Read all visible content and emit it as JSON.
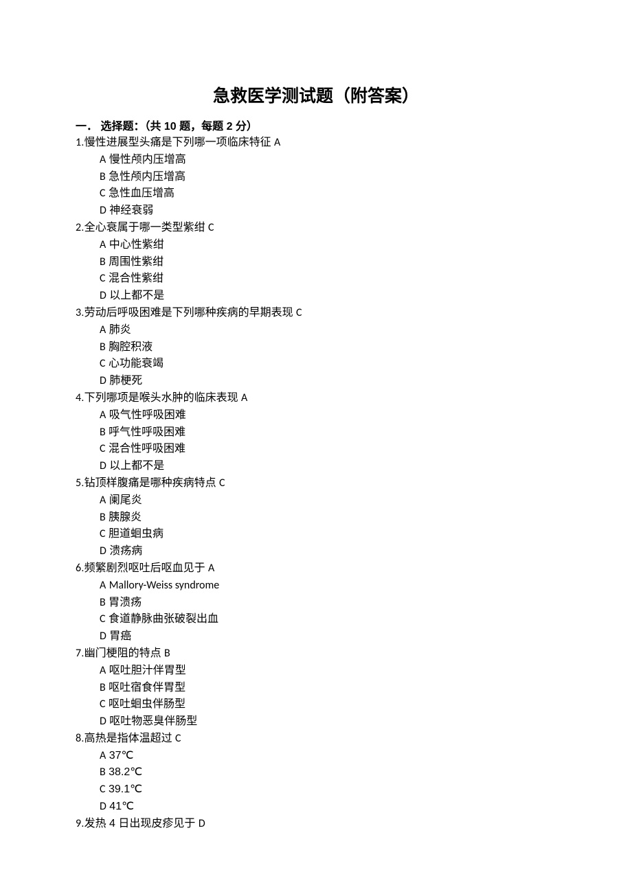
{
  "title": "急救医学测试题（附答案）",
  "section_heading": "一．  选择题：（共 10 题，每题 2 分）",
  "questions": [
    {
      "num": "1",
      "stem": "慢性进展型头痛是下列哪一项临床特征",
      "answer": "A",
      "options": [
        {
          "letter": "A",
          "text": "慢性颅内压增高"
        },
        {
          "letter": "B",
          "text": "急性颅内压增高"
        },
        {
          "letter": "C",
          "text": "急性血压增高"
        },
        {
          "letter": "D",
          "text": "神经衰弱"
        }
      ]
    },
    {
      "num": "2",
      "stem": "全心衰属于哪一类型紫绀",
      "answer": "C",
      "options": [
        {
          "letter": "A",
          "text": "中心性紫绀"
        },
        {
          "letter": "B",
          "text": "周围性紫绀"
        },
        {
          "letter": "C",
          "text": "混合性紫绀"
        },
        {
          "letter": "D",
          "text": "以上都不是"
        }
      ]
    },
    {
      "num": "3",
      "stem": "劳动后呼吸困难是下列哪种疾病的早期表现",
      "answer": "C",
      "options": [
        {
          "letter": "A",
          "text": "肺炎"
        },
        {
          "letter": "B",
          "text": "胸腔积液"
        },
        {
          "letter": "C",
          "text": "心功能衰竭"
        },
        {
          "letter": "D",
          "text": "肺梗死"
        }
      ]
    },
    {
      "num": "4",
      "stem": "下列哪项是喉头水肿的临床表现",
      "answer": "A",
      "options": [
        {
          "letter": "A",
          "text": "吸气性呼吸困难"
        },
        {
          "letter": "B",
          "text": "呼气性呼吸困难"
        },
        {
          "letter": "C",
          "text": "混合性呼吸困难"
        },
        {
          "letter": "D",
          "text": "以上都不是"
        }
      ]
    },
    {
      "num": "5",
      "stem": "钻顶样腹痛是哪种疾病特点",
      "answer": "C",
      "options": [
        {
          "letter": "A",
          "text": "阑尾炎"
        },
        {
          "letter": "B",
          "text": "胰腺炎"
        },
        {
          "letter": "C",
          "text": "胆道蛔虫病"
        },
        {
          "letter": "D",
          "text": "溃疡病"
        }
      ]
    },
    {
      "num": "6",
      "stem": "频繁剧烈呕吐后呕血见于",
      "answer": "A",
      "options": [
        {
          "letter": "A",
          "text": "Mallory-Weiss syndrome"
        },
        {
          "letter": "B",
          "text": "胃溃疡"
        },
        {
          "letter": "C",
          "text": "食道静脉曲张破裂出血"
        },
        {
          "letter": "D",
          "text": "胃癌"
        }
      ]
    },
    {
      "num": "7",
      "stem": "幽门梗阻的特点",
      "answer": "B",
      "options": [
        {
          "letter": "A",
          "text": "呕吐胆汁伴胃型"
        },
        {
          "letter": "B",
          "text": "呕吐宿食伴胃型"
        },
        {
          "letter": "C",
          "text": "呕吐蛔虫伴肠型"
        },
        {
          "letter": "D",
          "text": "呕吐物恶臭伴肠型"
        }
      ]
    },
    {
      "num": "8",
      "stem": "高热是指体温超过",
      "answer": "C",
      "options": [
        {
          "letter": "A",
          "text": "37℃"
        },
        {
          "letter": "B",
          "text": "38.2℃"
        },
        {
          "letter": "C",
          "text": "39.1℃"
        },
        {
          "letter": "D",
          "text": "41℃"
        }
      ]
    },
    {
      "num": "9",
      "stem": "发热 4 日出现皮疹见于",
      "answer": "D",
      "options": []
    }
  ]
}
